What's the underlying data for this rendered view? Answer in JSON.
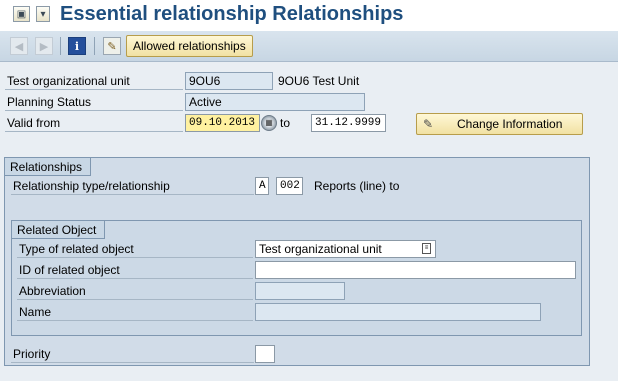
{
  "window": {
    "title": "Essential relationship Relationships"
  },
  "toolbar": {
    "allowed_relationships_label": "Allowed relationships",
    "icons": [
      "first-page-icon",
      "last-page-icon",
      "information-icon",
      "edit-icon"
    ]
  },
  "header": {
    "org_unit": {
      "label": "Test organizational unit",
      "value": "9OU6",
      "description": "9OU6 Test Unit"
    },
    "planning_status": {
      "label": "Planning Status",
      "value": "Active"
    },
    "validity": {
      "label": "Valid from",
      "from": "09.10.2013",
      "to_label": "to",
      "to": "31.12.9999"
    },
    "change_info_label": "Change Information"
  },
  "relationships": {
    "group_title": "Relationships",
    "type_label": "Relationship type/relationship",
    "type_code": "A",
    "relationship_code": "002",
    "relationship_text": "Reports (line) to"
  },
  "related_object": {
    "group_title": "Related Object",
    "type_label": "Type of related object",
    "type_value": "Test organizational unit",
    "id_label": "ID of related object",
    "id_value": "",
    "abbreviation_label": "Abbreviation",
    "abbreviation_value": "",
    "name_label": "Name",
    "name_value": ""
  },
  "priority": {
    "label": "Priority",
    "value": ""
  },
  "colors": {
    "title": "#1f4f7f",
    "focus_field": "#fff1a0",
    "button": "#f1e1a3"
  }
}
